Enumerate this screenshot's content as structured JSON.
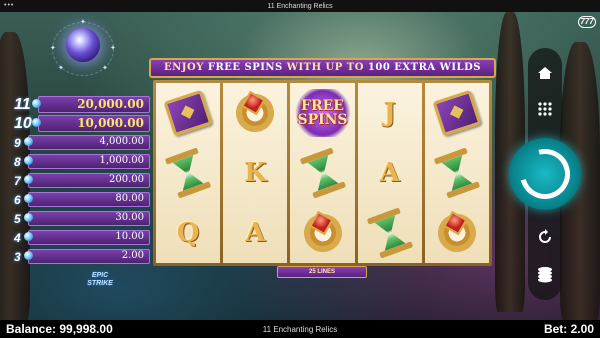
{
  "window": {
    "title": "11 Enchanting Relics"
  },
  "banner": {
    "prefix": "ENJOY ",
    "free_spins": "FREE SPINS",
    "middle": " WITH UP TO ",
    "extra_wilds": "100 EXTRA WILDS"
  },
  "paytable": [
    {
      "count": "11",
      "value": "20,000.00",
      "big": true
    },
    {
      "count": "10",
      "value": "10,000.00",
      "big": true
    },
    {
      "count": "9",
      "value": "4,000.00"
    },
    {
      "count": "8",
      "value": "1,000.00"
    },
    {
      "count": "7",
      "value": "200.00"
    },
    {
      "count": "6",
      "value": "80.00"
    },
    {
      "count": "5",
      "value": "30.00"
    },
    {
      "count": "4",
      "value": "10.00"
    },
    {
      "count": "3",
      "value": "2.00"
    }
  ],
  "epic_strike": {
    "line1": "EPIC",
    "line2": "STRIKE"
  },
  "reels": [
    [
      "book",
      "hourglass",
      "Q"
    ],
    [
      "ring",
      "K",
      "A"
    ],
    [
      "free-spins",
      "hourglass",
      "ring"
    ],
    [
      "J",
      "A",
      "hourglass"
    ],
    [
      "book",
      "hourglass",
      "ring"
    ]
  ],
  "free_spins_symbol": {
    "line1": "FREE",
    "line2": "SPINS"
  },
  "lines_label": "25 LINES",
  "logo": "777",
  "footer": {
    "balance": "Balance: 99,998.00",
    "game_title": "11 Enchanting Relics",
    "bet": "Bet: 2.00"
  },
  "colors": {
    "accent": "#7a3fae",
    "gold": "#d6a84a",
    "spin": "#1bb9c7"
  },
  "icons": [
    "home-icon",
    "menu-grid-icon",
    "spin-icon",
    "autoplay-icon",
    "coins-icon"
  ]
}
